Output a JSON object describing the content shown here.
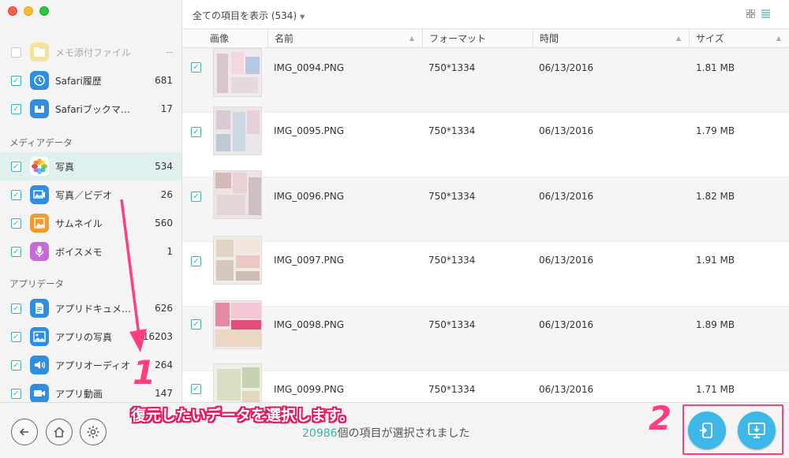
{
  "sidebar": {
    "items_top": [
      {
        "label": "メモ添付ファイル",
        "count": "--",
        "icon": "folder-icon",
        "color": "#f3d46a",
        "dim": true
      },
      {
        "label": "Safari履歴",
        "count": "681",
        "icon": "clock-icon",
        "color": "#2f8ee0"
      },
      {
        "label": "Safariブックマ…",
        "count": "17",
        "icon": "bookmark-icon",
        "color": "#2f8ee0"
      }
    ],
    "media_section": "メディアデータ",
    "media_items": [
      {
        "label": "写真",
        "count": "534",
        "icon": "photos-icon",
        "color": "#ffffff"
      },
      {
        "label": "写真／ビデオ",
        "count": "26",
        "icon": "photo-video-icon",
        "color": "#2f8ee0"
      },
      {
        "label": "サムネイル",
        "count": "560",
        "icon": "thumbnail-icon",
        "color": "#f29b2a"
      },
      {
        "label": "ボイスメモ",
        "count": "1",
        "icon": "microphone-icon",
        "color": "#c56ad9"
      }
    ],
    "app_section": "アプリデータ",
    "app_items": [
      {
        "label": "アプリドキュメ…",
        "count": "626",
        "icon": "document-icon",
        "color": "#2f8ee0"
      },
      {
        "label": "アプリの写真",
        "count": "16203",
        "icon": "image-icon",
        "color": "#2f8ee0"
      },
      {
        "label": "アプリオーディオ",
        "count": "264",
        "icon": "speaker-icon",
        "color": "#2f8ee0"
      },
      {
        "label": "アプリ動画",
        "count": "147",
        "icon": "video-icon",
        "color": "#2f8ee0"
      }
    ]
  },
  "topbar": {
    "filter": "全ての項目を表示 (534)"
  },
  "table": {
    "headers": [
      "画像",
      "名前",
      "フォーマット",
      "時間",
      "サイズ"
    ],
    "rows": [
      {
        "name": "IMG_0094.PNG",
        "format": "750*1334",
        "time": "06/13/2016",
        "size": "1.81 MB"
      },
      {
        "name": "IMG_0095.PNG",
        "format": "750*1334",
        "time": "06/13/2016",
        "size": "1.79 MB"
      },
      {
        "name": "IMG_0096.PNG",
        "format": "750*1334",
        "time": "06/13/2016",
        "size": "1.82 MB"
      },
      {
        "name": "IMG_0097.PNG",
        "format": "750*1334",
        "time": "06/13/2016",
        "size": "1.91 MB"
      },
      {
        "name": "IMG_0098.PNG",
        "format": "750*1334",
        "time": "06/13/2016",
        "size": "1.89 MB"
      },
      {
        "name": "IMG_0099.PNG",
        "format": "750*1334",
        "time": "06/13/2016",
        "size": "1.71 MB"
      }
    ]
  },
  "status": {
    "count": "20986",
    "text": "個の項目が選択されました"
  },
  "annotation": {
    "text": "復元したいデータを選択します。",
    "step1": "1",
    "step2": "2"
  },
  "colors": {
    "accent": "#3ab5a9",
    "highlight": "#ff3d7f",
    "action": "#3cb7e8"
  }
}
